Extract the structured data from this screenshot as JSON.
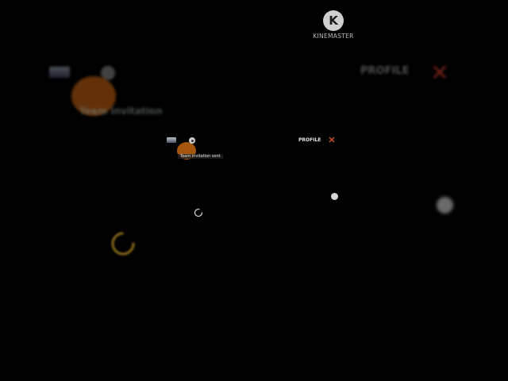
{
  "watermark": {
    "logo_letter": "K",
    "text": "KINEMASTER"
  },
  "background_overlay": {
    "invite_text": "Team invitation",
    "profile_label": "PROFILE",
    "close_icon": "close-icon"
  },
  "toolbar": {
    "profile_label": "PROFILE",
    "close_glyph": "✕"
  },
  "toast": {
    "message": "Team invitation sent"
  },
  "colors": {
    "avatar": "#c1650f",
    "close": "#d34a2b",
    "spinner": "#d4a017"
  }
}
